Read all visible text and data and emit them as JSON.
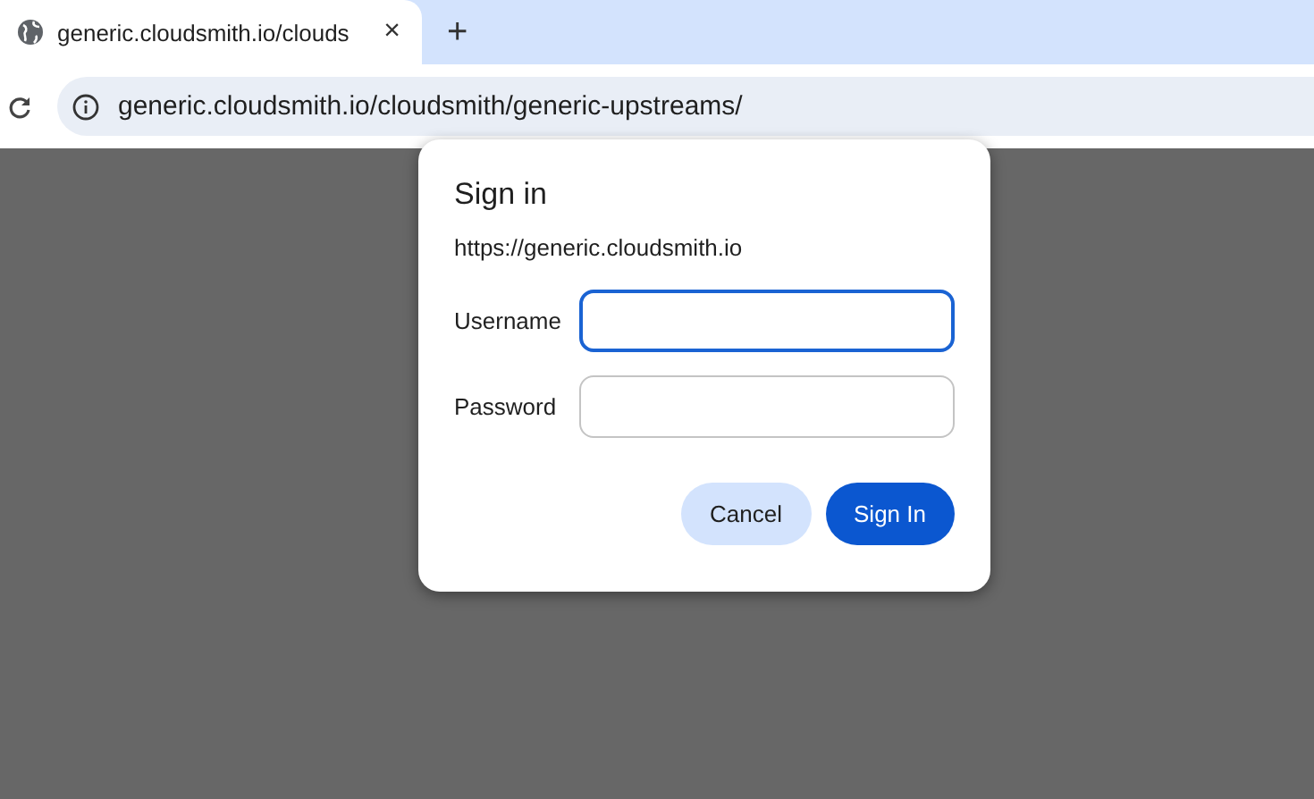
{
  "tabs": [
    {
      "title": "generic.cloudsmith.io/clouds",
      "close": "×",
      "selected": true
    }
  ],
  "new_tab": "+",
  "address_bar": {
    "url": "generic.cloudsmith.io/cloudsmith/generic-upstreams/"
  },
  "dialog": {
    "title": "Sign in",
    "origin": "https://generic.cloudsmith.io",
    "fields": [
      {
        "label": "Username",
        "focused": true
      },
      {
        "label": "Password",
        "focused": false
      }
    ],
    "buttons": [
      {
        "label": "Cancel",
        "kind": "secondary"
      },
      {
        "label": "Sign In",
        "kind": "primary"
      }
    ]
  }
}
